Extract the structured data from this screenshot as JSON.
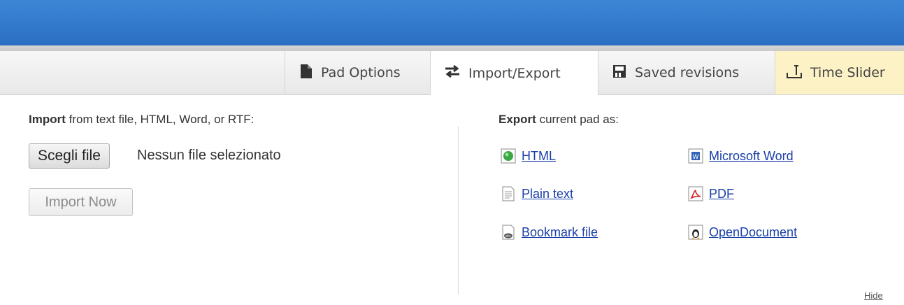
{
  "toolbar": {
    "tabs": {
      "pad_options": "Pad Options",
      "import_export": "Import/Export",
      "saved_revisions": "Saved revisions",
      "time_slider": "Time Slider"
    }
  },
  "import": {
    "title_bold": "Import",
    "title_rest": " from text file, HTML, Word, or RTF:",
    "choose_file_label": "Scegli file",
    "no_file_text": "Nessun file selezionato",
    "import_now_label": "Import Now"
  },
  "export": {
    "title_bold": "Export",
    "title_rest": " current pad as:",
    "formats": {
      "html": "HTML",
      "plain_text": "Plain text",
      "bookmark": "Bookmark file",
      "word": "Microsoft Word",
      "pdf": "PDF",
      "opendocument": "OpenDocument"
    }
  },
  "hide_label": "Hide",
  "colors": {
    "header_blue": "#2f76c8",
    "active_tab": "#ffffff",
    "time_slider_bg": "#fdf2c6",
    "link": "#1a3fa8"
  }
}
